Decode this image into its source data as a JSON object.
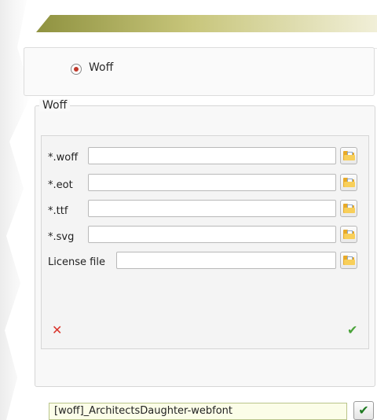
{
  "format_option": {
    "label": "Woff",
    "selected": true
  },
  "group": {
    "title": "Woff"
  },
  "fields": [
    {
      "label": "*.woff",
      "value": ""
    },
    {
      "label": "*.eot",
      "value": ""
    },
    {
      "label": "*.ttf",
      "value": ""
    },
    {
      "label": "*.svg",
      "value": ""
    },
    {
      "label": "License file",
      "value": ""
    }
  ],
  "actions": {
    "cancel_icon": "x-icon",
    "confirm_icon": "check-icon"
  },
  "status": {
    "value": "[woff]_ArchitectsDaughter-webfont"
  },
  "colors": {
    "accent_bar": "#8f9240",
    "cancel": "#d9342b",
    "confirm": "#4aa33a",
    "radio_dot": "#c0392b"
  }
}
